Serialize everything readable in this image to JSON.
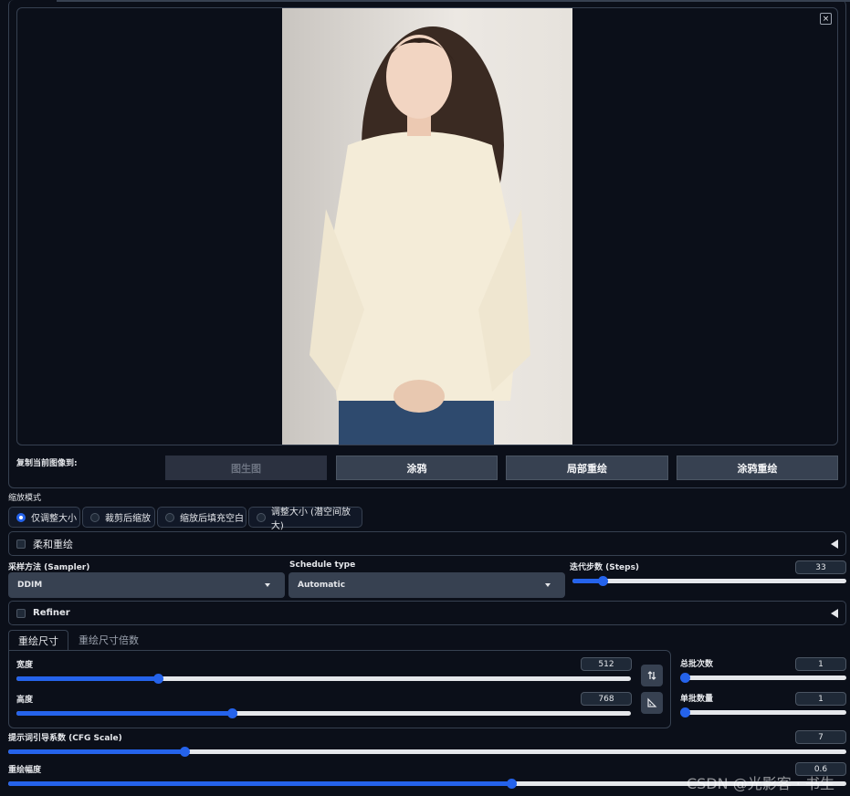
{
  "image_panel": {
    "close_glyph": "×"
  },
  "copy_to": {
    "label": "复制当前图像到:",
    "buttons": [
      "图生图",
      "涂鸦",
      "局部重绘",
      "涂鸦重绘"
    ]
  },
  "resize_mode": {
    "label": "缩放模式",
    "options": [
      "仅调整大小",
      "裁剪后缩放",
      "缩放后填充空白",
      "调整大小 (潜空间放大)"
    ],
    "selected": "仅调整大小"
  },
  "soft_inpaint": {
    "label": "柔和重绘"
  },
  "sampler": {
    "label": "采样方法 (Sampler)",
    "value": "DDIM"
  },
  "schedule": {
    "label": "Schedule type",
    "value": "Automatic"
  },
  "steps": {
    "label": "迭代步数 (Steps)",
    "value": "33",
    "fraction": 0.11
  },
  "refiner": {
    "label": "Refiner"
  },
  "size_tabs": [
    "重绘尺寸",
    "重绘尺寸倍数"
  ],
  "width": {
    "label": "宽度",
    "value": "512",
    "fraction": 0.23
  },
  "height": {
    "label": "高度",
    "value": "768",
    "fraction": 0.35
  },
  "batch_count": {
    "label": "总批次数",
    "value": "1",
    "fraction": 0.0
  },
  "batch_size": {
    "label": "单批数量",
    "value": "1",
    "fraction": 0.0
  },
  "cfg": {
    "label": "提示词引导系数 (CFG Scale)",
    "value": "7",
    "fraction": 0.21
  },
  "denoise": {
    "label": "重绘幅度",
    "value": "0.6",
    "fraction": 0.6
  },
  "watermark": "CSDN @光影客 · 书生",
  "colors": {
    "accent": "#2563eb",
    "background": "#0b0f19",
    "panel_border": "#374151"
  }
}
